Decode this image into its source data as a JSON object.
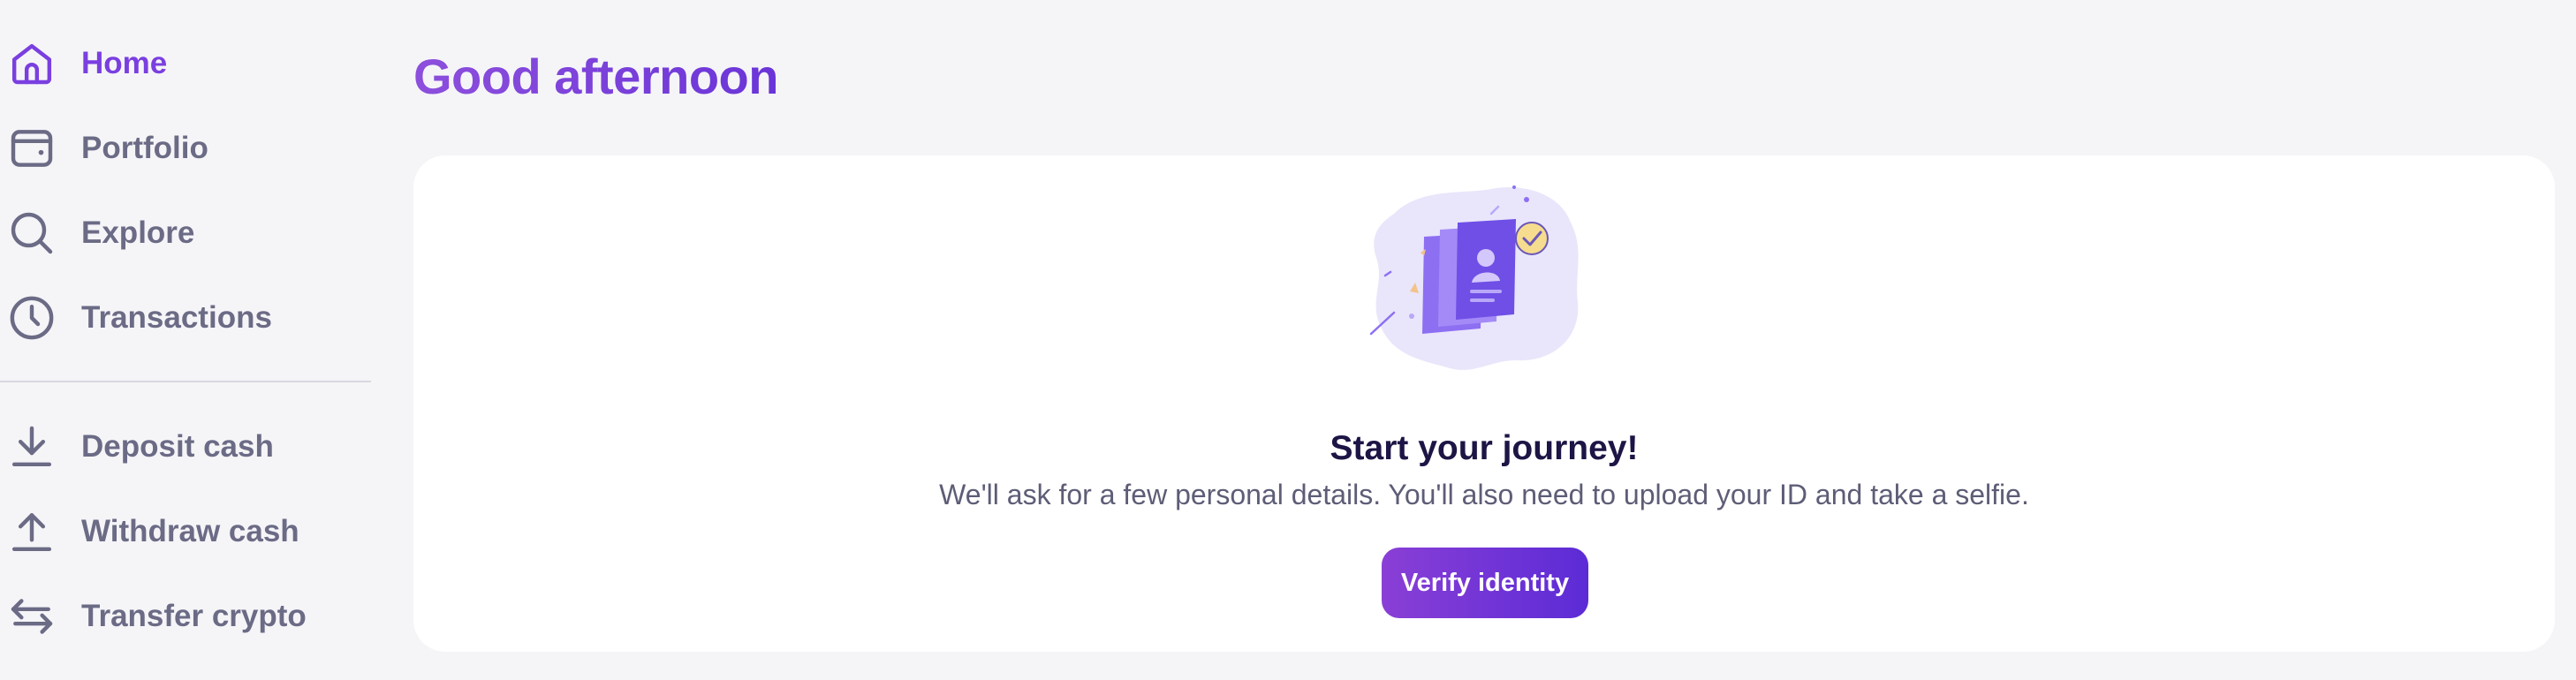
{
  "sidebar": {
    "items": [
      {
        "label": "Home",
        "icon": "home-icon",
        "active": true
      },
      {
        "label": "Portfolio",
        "icon": "wallet-icon"
      },
      {
        "label": "Explore",
        "icon": "search-icon"
      },
      {
        "label": "Transactions",
        "icon": "clock-icon"
      },
      {
        "label": "Deposit cash",
        "icon": "download-icon"
      },
      {
        "label": "Withdraw cash",
        "icon": "upload-icon"
      },
      {
        "label": "Transfer crypto",
        "icon": "transfer-arrows-icon"
      }
    ]
  },
  "main": {
    "title": "Good afternoon",
    "card": {
      "illustration": "identity-documents-illustration",
      "heading": "Start your journey!",
      "body": "We'll ask for a few personal details. You'll also need to upload your ID and take a selfie.",
      "button_label": "Verify identity"
    }
  },
  "colors": {
    "accent": "#7a3fe0",
    "nav_text": "#6b6b86",
    "background": "#f5f5f8",
    "heading": "#1c1545"
  }
}
